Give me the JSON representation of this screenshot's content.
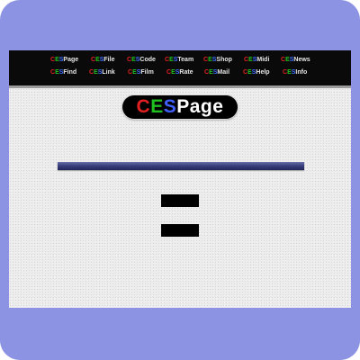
{
  "brand": {
    "c": "C",
    "e": "E",
    "s": "S"
  },
  "nav": {
    "row1": [
      {
        "suffix": "Page"
      },
      {
        "suffix": "File"
      },
      {
        "suffix": "Code"
      },
      {
        "suffix": "Team"
      },
      {
        "suffix": "Shop"
      },
      {
        "suffix": "Midi"
      },
      {
        "suffix": "News"
      }
    ],
    "row2": [
      {
        "suffix": "Find"
      },
      {
        "suffix": "Link"
      },
      {
        "suffix": "Film"
      },
      {
        "suffix": "Rate"
      },
      {
        "suffix": "Mail"
      },
      {
        "suffix": "Help"
      },
      {
        "suffix": "Info"
      }
    ]
  },
  "logo": {
    "c": "C",
    "e": "E",
    "s": "S",
    "rest": "Page"
  },
  "colors": {
    "background": "#8b93e2",
    "page": "#ececec",
    "navbar": "#0a0a0a",
    "brand_c": "#e02020",
    "brand_e": "#20c020",
    "brand_s": "#4060ff",
    "rule": "#3a3f7c"
  }
}
